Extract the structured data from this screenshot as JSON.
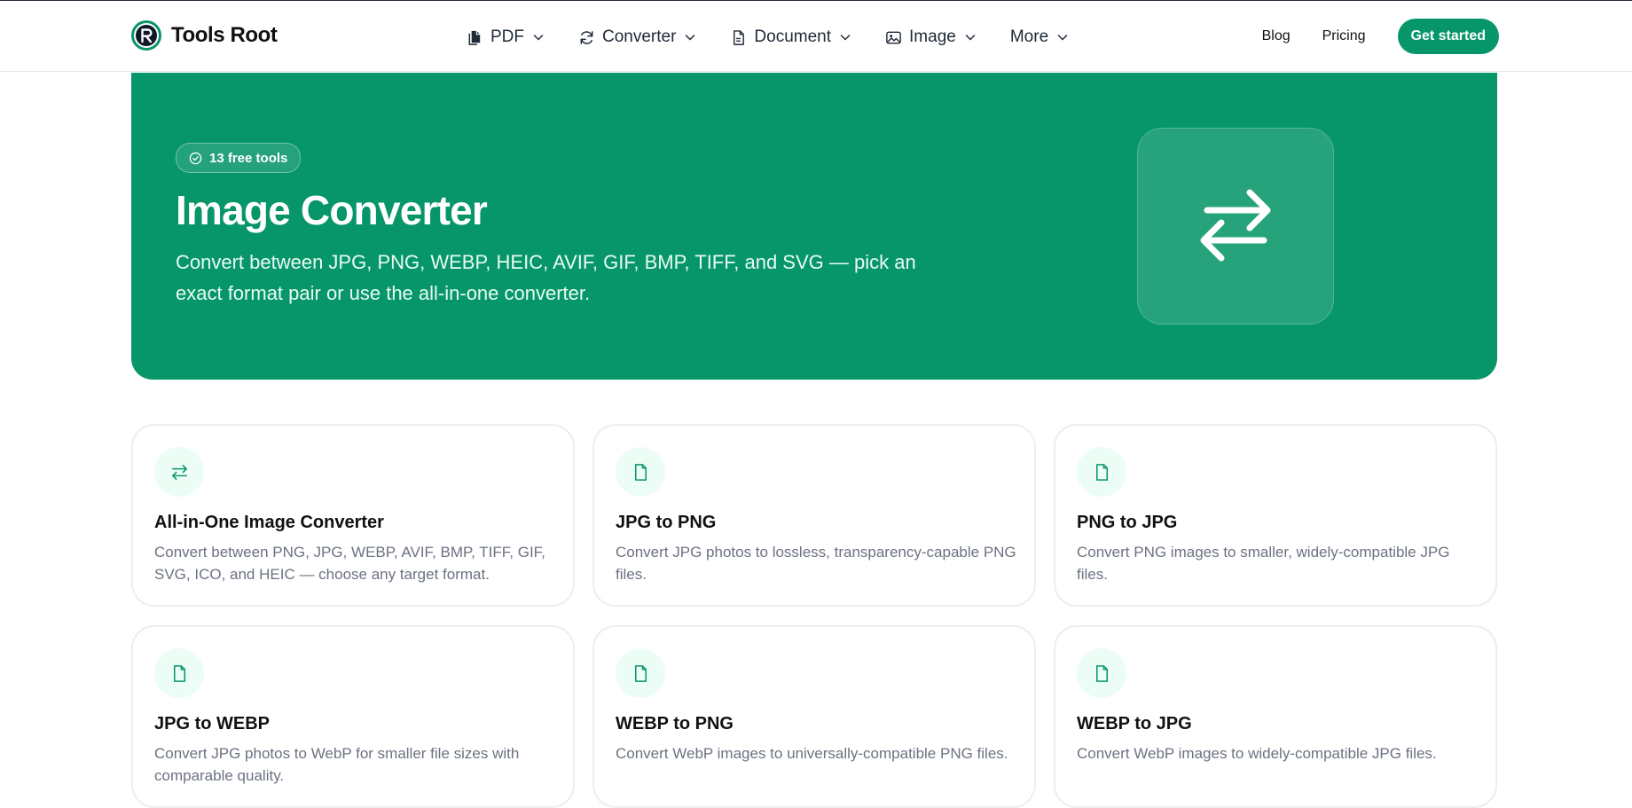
{
  "brand": {
    "name": "Tools Root",
    "accent": "#079669"
  },
  "nav": {
    "items": [
      {
        "label": "PDF",
        "icon": "files-icon"
      },
      {
        "label": "Converter",
        "icon": "refresh-icon"
      },
      {
        "label": "Document",
        "icon": "document-icon"
      },
      {
        "label": "Image",
        "icon": "image-icon"
      },
      {
        "label": "More",
        "icon": ""
      }
    ],
    "blog": "Blog",
    "pricing": "Pricing",
    "cta": "Get started"
  },
  "hero": {
    "badge": "13 free tools",
    "title": "Image Converter",
    "description": "Convert between JPG, PNG, WEBP, HEIC, AVIF, GIF, BMP, TIFF, and SVG — pick an exact format pair or use the all-in-one converter.",
    "icon": "arrows-swap-icon"
  },
  "tools": [
    {
      "title": "All-in-One Image Converter",
      "description": "Convert between PNG, JPG, WEBP, AVIF, BMP, TIFF, GIF, SVG, ICO, and HEIC — choose any target format.",
      "icon": "arrows-swap-icon"
    },
    {
      "title": "JPG to PNG",
      "description": "Convert JPG photos to lossless, transparency-capable PNG files.",
      "icon": "file-icon"
    },
    {
      "title": "PNG to JPG",
      "description": "Convert PNG images to smaller, widely-compatible JPG files.",
      "icon": "file-icon"
    },
    {
      "title": "JPG to WEBP",
      "description": "Convert JPG photos to WebP for smaller file sizes with comparable quality.",
      "icon": "file-icon"
    },
    {
      "title": "WEBP to PNG",
      "description": "Convert WebP images to universally-compatible PNG files.",
      "icon": "file-icon"
    },
    {
      "title": "WEBP to JPG",
      "description": "Convert WebP images to widely-compatible JPG files.",
      "icon": "file-icon"
    }
  ]
}
